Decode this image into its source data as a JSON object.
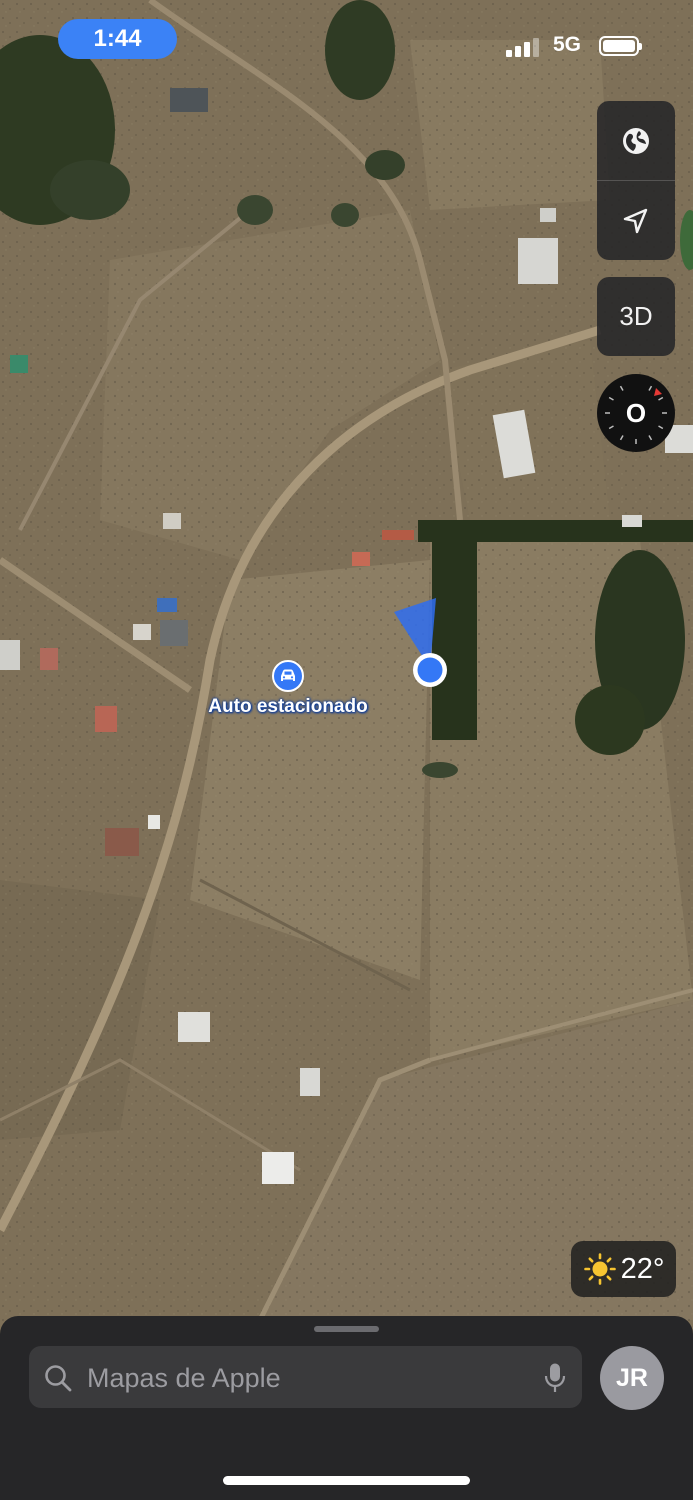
{
  "status_bar": {
    "time": "1:44",
    "network": "5G"
  },
  "map": {
    "parked_car_label": "Auto estacionado",
    "user_location": "current-location"
  },
  "controls": {
    "map_type_icon": "globe-icon",
    "location_icon": "location-arrow-icon",
    "view_3d_label": "3D",
    "compass_label": "O"
  },
  "weather": {
    "icon": "sun-icon",
    "temperature": "22°"
  },
  "bottom_sheet": {
    "search_placeholder": "Mapas de Apple",
    "avatar_initials": "JR"
  },
  "colors": {
    "accent": "#3478f6",
    "time_pill": "#3b82f6",
    "sheet_bg": "#262628"
  }
}
